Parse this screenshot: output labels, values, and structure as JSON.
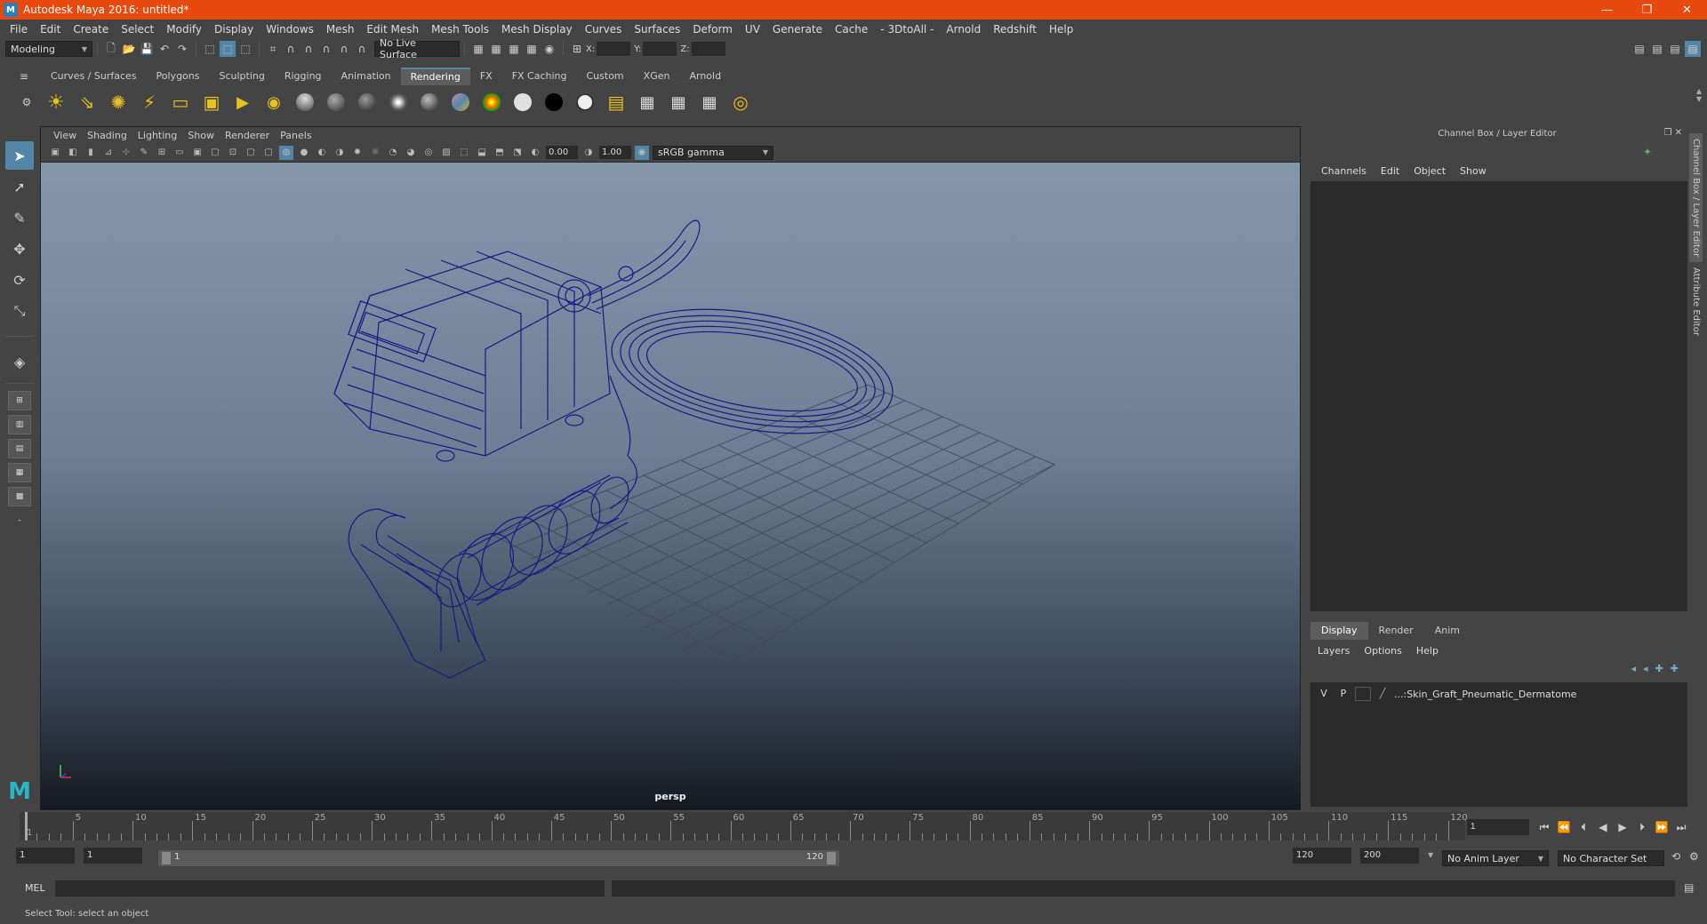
{
  "window": {
    "title": "Autodesk Maya 2016: untitled*",
    "controls": [
      "—",
      "❐",
      "✕"
    ]
  },
  "menubar": [
    "File",
    "Edit",
    "Create",
    "Select",
    "Modify",
    "Display",
    "Windows",
    "Mesh",
    "Edit Mesh",
    "Mesh Tools",
    "Mesh Display",
    "Curves",
    "Surfaces",
    "Deform",
    "UV",
    "Generate",
    "Cache",
    "- 3DtoAll -",
    "Arnold",
    "Redshift",
    "Help"
  ],
  "statusline": {
    "menuset": "Modeling",
    "live_surface": "No Live Surface",
    "coord_labels": {
      "x": "X:",
      "y": "Y:",
      "z": "Z:"
    }
  },
  "shelf": {
    "tabs": [
      "Curves / Surfaces",
      "Polygons",
      "Sculpting",
      "Rigging",
      "Animation",
      "Rendering",
      "FX",
      "FX Caching",
      "Custom",
      "XGen",
      "Arnold"
    ],
    "active_tab": "Rendering",
    "colors": {
      "light_icon": "#e8c31e",
      "accent": "#5285a6"
    }
  },
  "viewport": {
    "menu": [
      "View",
      "Shading",
      "Lighting",
      "Show",
      "Renderer",
      "Panels"
    ],
    "exposure": "0.00",
    "gamma": "1.00",
    "color_space": "sRGB gamma",
    "camera_label": "persp",
    "wire_color": "#151a82"
  },
  "right_panel": {
    "title": "Channel Box / Layer Editor",
    "menu": [
      "Channels",
      "Edit",
      "Object",
      "Show"
    ],
    "layer_tabs": [
      "Display",
      "Render",
      "Anim"
    ],
    "active_layer_tab": "Display",
    "layer_menu": [
      "Layers",
      "Options",
      "Help"
    ],
    "layer": {
      "v": "V",
      "p": "P",
      "name": "...:Skin_Graft_Pneumatic_Dermatome"
    },
    "side_tabs": [
      "Channel Box / Layer Editor",
      "Attribute Editor"
    ]
  },
  "timeline": {
    "tick_labels": [
      "5",
      "10",
      "15",
      "20",
      "25",
      "30",
      "35",
      "40",
      "45",
      "50",
      "55",
      "60",
      "65",
      "70",
      "75",
      "80",
      "85",
      "90",
      "95",
      "100",
      "105",
      "110",
      "115",
      "120"
    ],
    "start_marker": "1",
    "current_frame": "1"
  },
  "range": {
    "start": "1",
    "playback_start": "1",
    "slider_start": "1",
    "slider_end": "120",
    "playback_end": "120",
    "end": "200",
    "anim_layer": "No Anim Layer",
    "character_set": "No Character Set"
  },
  "command": {
    "label": "MEL"
  },
  "help_line": "Select Tool: select an object"
}
